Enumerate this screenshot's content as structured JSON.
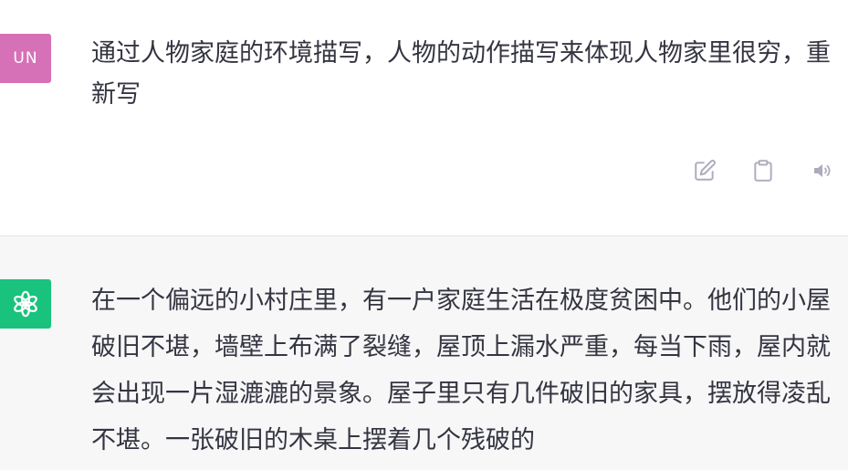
{
  "user_message": {
    "avatar_initials": "UN",
    "text": "通过人物家庭的环境描写，人物的动作描写来体现人物家里很穷，重新写",
    "actions": [
      {
        "icon": "edit-icon"
      },
      {
        "icon": "clipboard-icon"
      },
      {
        "icon": "speaker-icon"
      }
    ]
  },
  "assistant_message": {
    "avatar_icon": "openai-logo-icon",
    "text": "在一个偏远的小村庄里，有一户家庭生活在极度贫困中。他们的小屋破旧不堪，墙壁上布满了裂缝，屋顶上漏水严重，每当下雨，屋内就会出现一片湿漉漉的景象。屋子里只有几件破旧的家具，摆放得凌乱不堪。一张破旧的木桌上摆着几个残破的"
  },
  "colors": {
    "user_avatar_bg": "#d670b7",
    "assistant_avatar_bg": "#19c37d",
    "assistant_turn_bg": "#f7f7f8",
    "text": "#343541",
    "icon": "#acacbe"
  }
}
